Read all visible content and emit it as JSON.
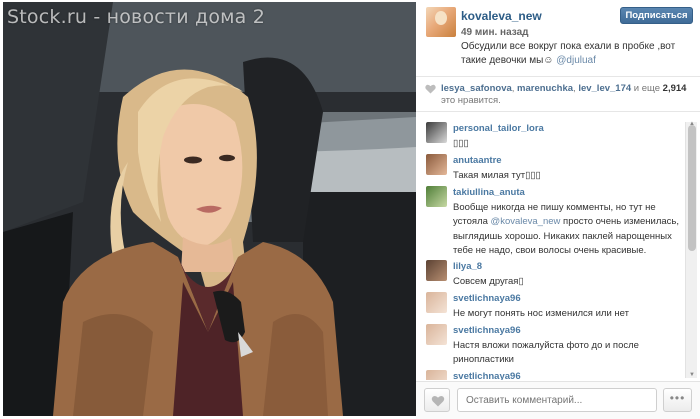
{
  "watermark": "Stock.ru - новости дома 2",
  "post": {
    "author": "kovaleva_new",
    "time": "49 мин. назад",
    "caption": "Обсудили все вокруг пока ехали в пробке ,вот такие девочки мы☺",
    "caption_mention": "@djuluaf",
    "subscribe_label": "Подписаться"
  },
  "likes": {
    "users": [
      "lesya_safonova",
      "marenuchka",
      "lev_lev_174"
    ],
    "separator": ", ",
    "and_more": "и еще",
    "count": "2,914",
    "suffix": "это нравится."
  },
  "comments": [
    {
      "user": "personal_tailor_lora",
      "text": "▯▯▯",
      "avatar_colors": [
        "#3b3b3b",
        "#d9d9d9"
      ]
    },
    {
      "user": "anutaantre",
      "text": "Такая милая тут▯▯▯",
      "avatar_colors": [
        "#8a5a3c",
        "#e4b899"
      ]
    },
    {
      "user": "takiullina_anuta",
      "text_before": "Вообще никогда не пишу комменты, но тут не устояла ",
      "mention": "@kovaleva_new",
      "text_after": " просто очень изменилась, выглядишь хорошо. Никаких паклей нарощенных тебе не надо, свои волосы очень красивые.",
      "avatar_colors": [
        "#4f7e38",
        "#c7d9a4"
      ]
    },
    {
      "user": "lilya_8",
      "text": "Совсем другая▯",
      "avatar_colors": [
        "#5b4233",
        "#b88f72"
      ]
    },
    {
      "user": "svetlichnaya96",
      "text": "Не могут понять нос изменился или нет",
      "avatar_colors": [
        "#d9b49a",
        "#f4e3d6"
      ]
    },
    {
      "user": "svetlichnaya96",
      "text": "Настя вложи пожалуйста фото до и после ринопластики",
      "avatar_colors": [
        "#d9b49a",
        "#f4e3d6"
      ]
    },
    {
      "user": "svetlichnaya96",
      "text": "",
      "avatar_colors": [
        "#d9b49a",
        "#f4e3d6"
      ]
    }
  ],
  "footer": {
    "comment_placeholder": "Оставить комментарий...",
    "more_label": "•••"
  },
  "colors": {
    "link": "#4b79a2",
    "button": "#3f6b97"
  },
  "icons": {
    "like": "heart-icon",
    "more": "ellipsis-icon"
  }
}
